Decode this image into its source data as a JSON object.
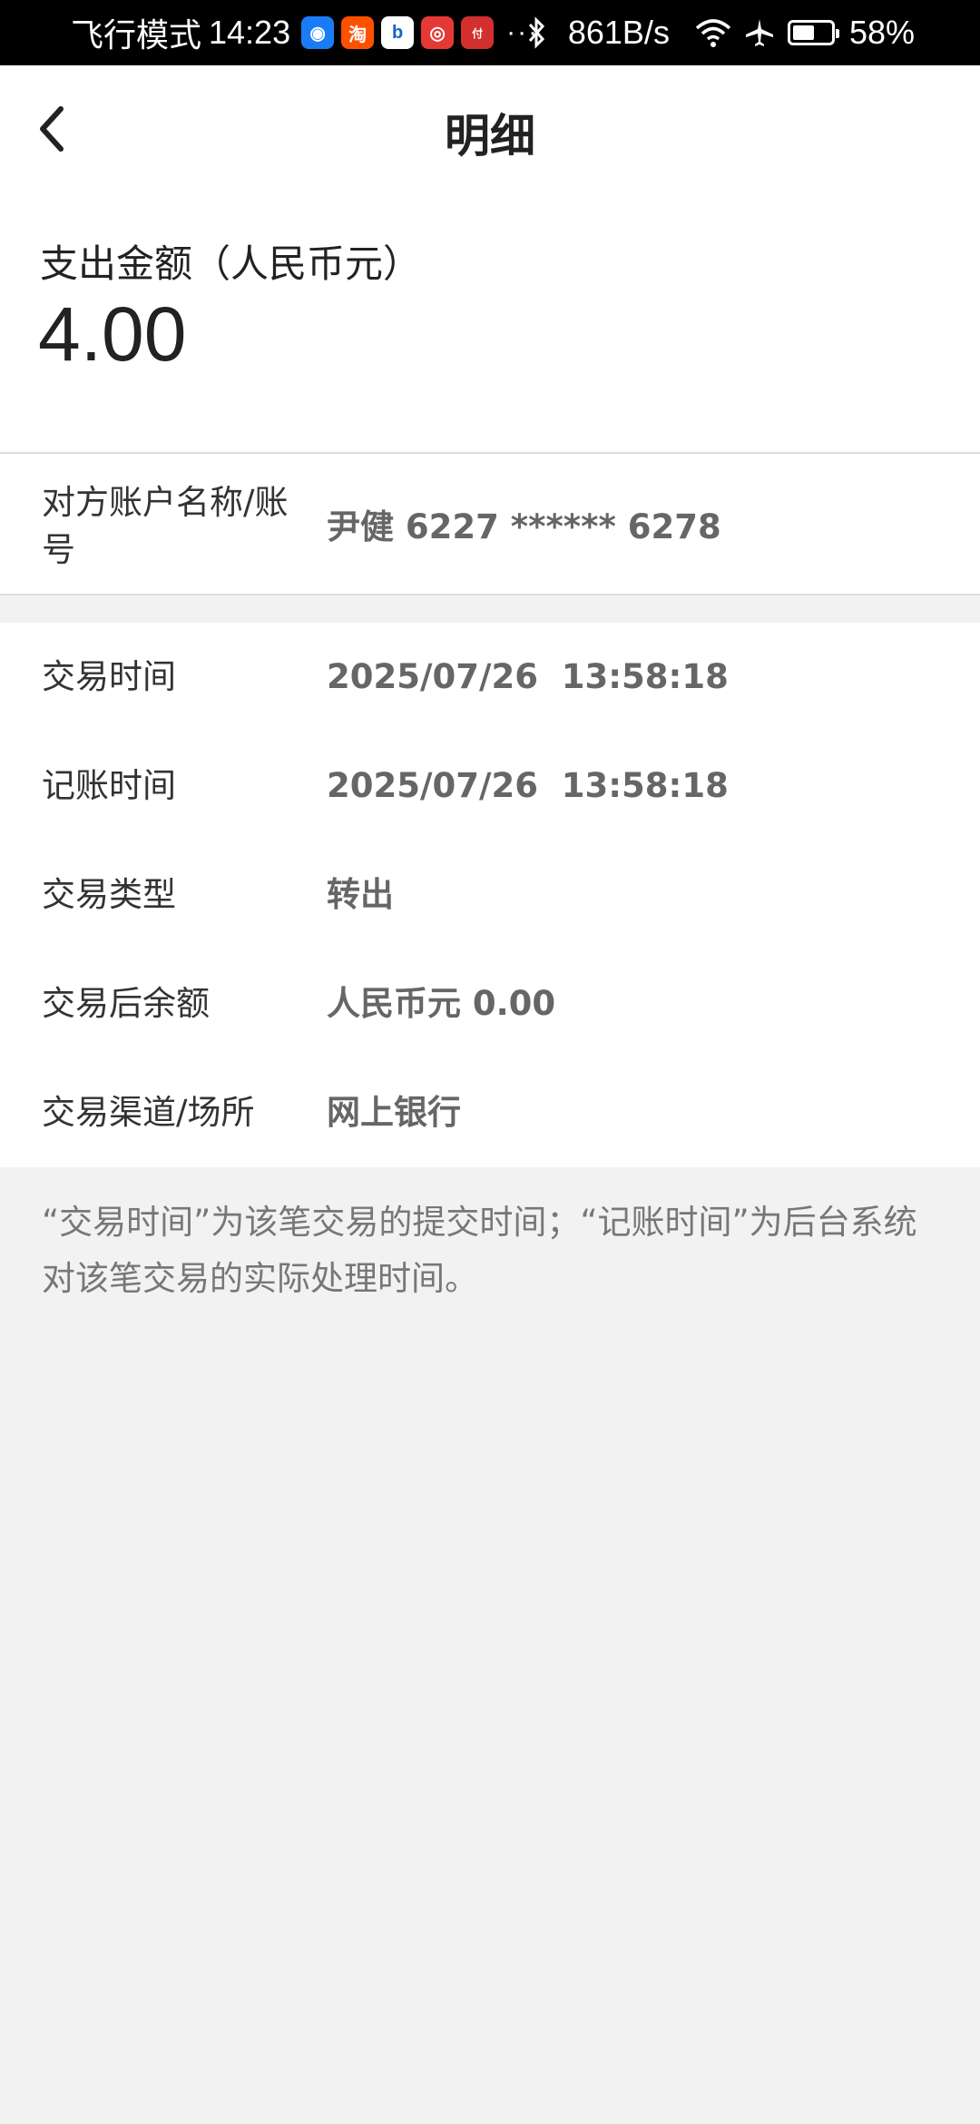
{
  "status_bar": {
    "mode": "飞行模式",
    "time": "14:23",
    "net_speed": "861B/s",
    "battery": "58%",
    "battery_level": 0.58,
    "more": "···",
    "app_icons": [
      {
        "name": "app-icon-blue",
        "color": "#1a7cf5"
      },
      {
        "name": "taobao-icon",
        "color": "#ff5000"
      },
      {
        "name": "app-icon-b",
        "color": "#1565c0"
      },
      {
        "name": "app-icon-red",
        "color": "#e53935"
      },
      {
        "name": "app-icon-pay",
        "color": "#d32f2f"
      }
    ]
  },
  "header": {
    "title": "明细",
    "back_icon": "chevron-left-icon"
  },
  "amount": {
    "label": "支出金额（人民币元）",
    "value": "4.00"
  },
  "account": {
    "label": "对方账户名称/账号",
    "value": "尹健 6227 ****** 6278"
  },
  "details": [
    {
      "label": "交易时间",
      "value": "2025/07/26  13:58:18"
    },
    {
      "label": "记账时间",
      "value": "2025/07/26  13:58:18"
    },
    {
      "label": "交易类型",
      "value": "转出"
    },
    {
      "label": "交易后余额",
      "value": "人民币元 0.00"
    },
    {
      "label": "交易渠道/场所",
      "value": "网上银行"
    }
  ],
  "note": "“交易时间”为该笔交易的提交时间；“记账时间”为后台系统对该笔交易的实际处理时间。"
}
